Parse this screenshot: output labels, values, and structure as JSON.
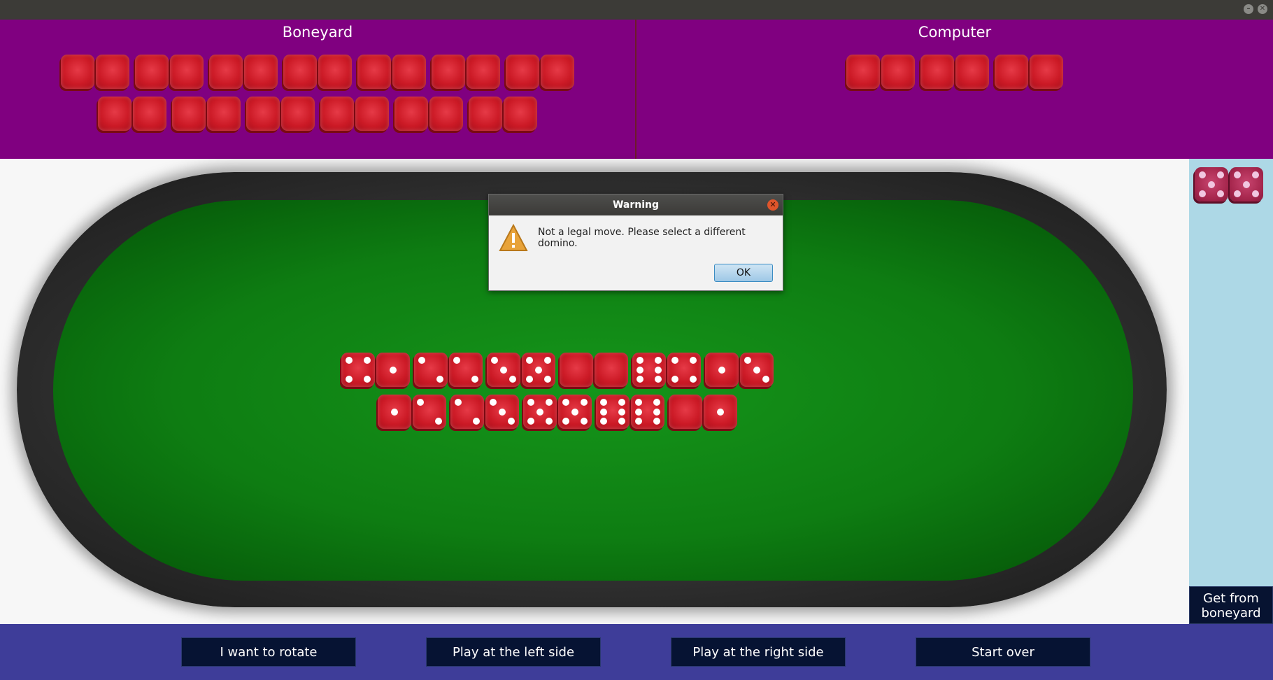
{
  "window": {
    "minimize_icon": "minus",
    "close_icon": "x"
  },
  "boneyard": {
    "title": "Boneyard",
    "row1_count": 7,
    "row2_count": 6
  },
  "computer": {
    "title": "Computer",
    "count": 3
  },
  "hand": {
    "dominoes": [
      [
        5,
        5
      ]
    ]
  },
  "board": {
    "row1": [
      [
        4,
        1
      ],
      [
        2,
        2
      ],
      [
        3,
        5
      ],
      [
        0,
        0
      ],
      [
        6,
        4
      ],
      [
        1,
        3
      ]
    ],
    "row2": [
      [
        1,
        2
      ],
      [
        2,
        3
      ],
      [
        5,
        5
      ],
      [
        6,
        6
      ],
      [
        0,
        1
      ]
    ]
  },
  "dialog": {
    "title": "Warning",
    "message": "Not a legal move. Please select a different domino.",
    "ok_label": "OK",
    "icon": "warning-icon"
  },
  "sidebar": {
    "get_button": "Get from boneyard"
  },
  "buttons": {
    "rotate": "I want to rotate",
    "left": "Play at the left side",
    "right": "Play at the right side",
    "start_over": "Start over"
  },
  "colors": {
    "panel": "#800080",
    "sidebar": "#add8e6",
    "bottom_bar": "#3e3d99",
    "button": "#061333",
    "domino": "#cc1a26",
    "felt": "#0e7d12"
  }
}
